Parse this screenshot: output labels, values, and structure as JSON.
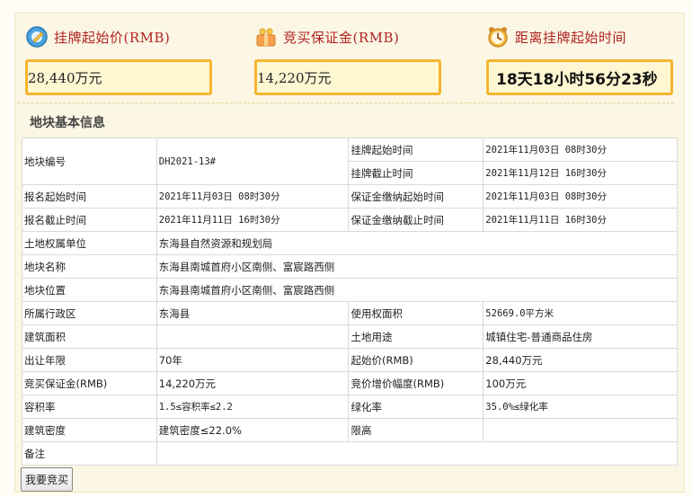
{
  "stats": {
    "start_price": {
      "label": "挂牌起始价(RMB)",
      "value": "28,440万元",
      "icon": "price-tag-icon"
    },
    "deposit": {
      "label": "竞买保证金(RMB)",
      "value": "14,220万元",
      "icon": "gift-coins-icon"
    },
    "countdown": {
      "label": "距离挂牌起始时间",
      "value": "18天18小时56分23秒",
      "icon": "alarm-clock-icon"
    }
  },
  "section_title": "地块基本信息",
  "table": {
    "parcel_no_label": "地块编号",
    "parcel_no": "DH2021-13#",
    "listing_start_label": "挂牌起始时间",
    "listing_start": "2021年11月03日 08时30分",
    "listing_end_label": "挂牌截止时间",
    "listing_end": "2021年11月12日 16时30分",
    "reg_start_label": "报名起始时间",
    "reg_start": "2021年11月03日 08时30分",
    "deposit_start_label": "保证金缴纳起始时间",
    "deposit_start": "2021年11月03日 08时30分",
    "reg_end_label": "报名截止时间",
    "reg_end": "2021年11月11日 16时30分",
    "deposit_end_label": "保证金缴纳截止时间",
    "deposit_end": "2021年11月11日 16时30分",
    "owner_label": "土地权属单位",
    "owner": "东海县自然资源和规划局",
    "name_label": "地块名称",
    "name": "东海县南城首府小区南侧、富宸路西侧",
    "location_label": "地块位置",
    "location": "东海县南城首府小区南侧、富宸路西侧",
    "district_label": "所属行政区",
    "district": "东海县",
    "use_area_label": "使用权面积",
    "use_area": "52669.0平方米",
    "build_area_label": "建筑面积",
    "build_area": "",
    "land_use_label": "土地用途",
    "land_use": "城镇住宅-普通商品住房",
    "term_label": "出让年限",
    "term": "70年",
    "start_price_label": "起始价(RMB)",
    "start_price": "28,440万元",
    "deposit_label": "竞买保证金(RMB)",
    "deposit": "14,220万元",
    "increment_label": "竞价增价幅度(RMB)",
    "increment": "100万元",
    "far_label": "容积率",
    "far": "1.5≤容积率≤2.2",
    "green_label": "绿化率",
    "green": "35.0%≤绿化率",
    "density_label": "建筑密度",
    "density": "建筑密度≤22.0%",
    "height_label": "限高",
    "height": "",
    "remark_label": "备注",
    "remark": ""
  },
  "buy_button": "我要竞买",
  "colors": {
    "accent_red": "#b22222",
    "box_border": "#f5b52f",
    "box_fill": "#fff7d2"
  }
}
